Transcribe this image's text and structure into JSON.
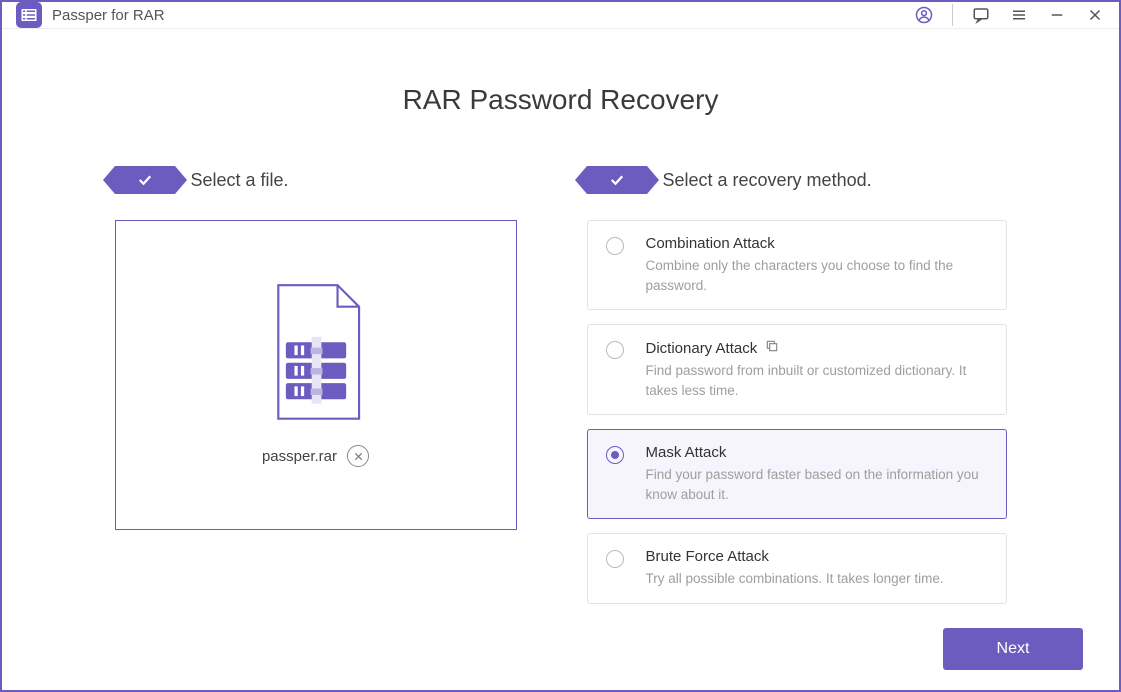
{
  "app": {
    "title": "Passper for RAR"
  },
  "page": {
    "title": "RAR Password Recovery"
  },
  "step1": {
    "title": "Select a file.",
    "filename": "passper.rar"
  },
  "step2": {
    "title": "Select a recovery method."
  },
  "methods": [
    {
      "title": "Combination Attack",
      "desc": "Combine only the characters you choose to find the password.",
      "selected": false,
      "extraIcon": false
    },
    {
      "title": "Dictionary Attack",
      "desc": "Find password from inbuilt or customized dictionary. It takes less time.",
      "selected": false,
      "extraIcon": true
    },
    {
      "title": "Mask Attack",
      "desc": "Find your password faster based on the information you know about it.",
      "selected": true,
      "extraIcon": false
    },
    {
      "title": "Brute Force Attack",
      "desc": "Try all possible combinations. It takes longer time.",
      "selected": false,
      "extraIcon": false
    }
  ],
  "footer": {
    "next_label": "Next"
  }
}
